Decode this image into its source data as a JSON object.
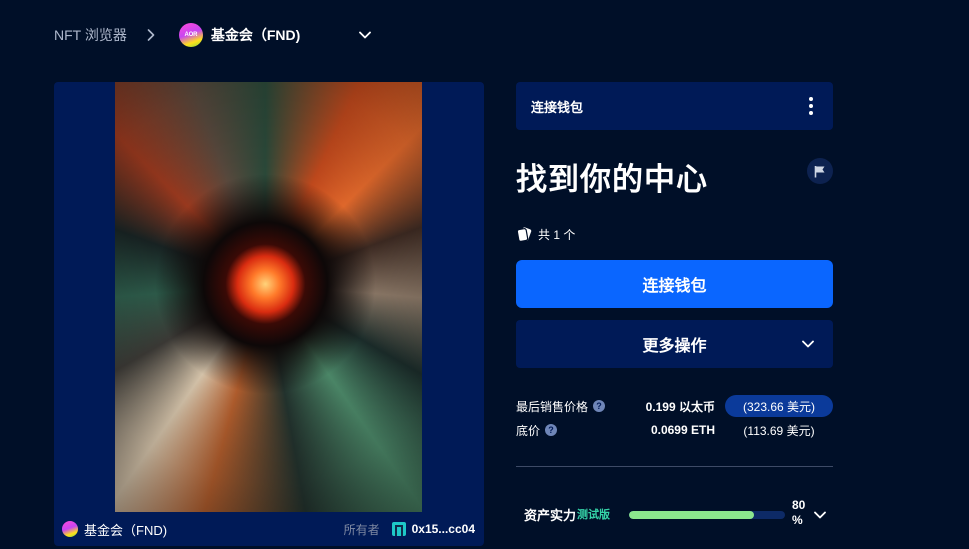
{
  "breadcrumb": {
    "root": "NFT 浏览器",
    "collection_avatar_text": "AOR",
    "collection": "基金会（FND)"
  },
  "media": {
    "collection": "基金会（FND)",
    "owner_label": "所有者",
    "owner": "0x15...cc04"
  },
  "topbar": {
    "label": "连接钱包"
  },
  "nft": {
    "title": "找到你的中心",
    "count": "共 1 个"
  },
  "actions": {
    "connect": "连接钱包",
    "more": "更多操作"
  },
  "prices": {
    "last_sale_label": "最后销售价格",
    "last_sale_value": "0.199 以太币",
    "last_sale_fiat": "(323.66 美元)",
    "floor_label": "底价",
    "floor_value": "0.0699 ETH",
    "floor_fiat": "(113.69 美元)"
  },
  "asset_strength": {
    "label": "资产实力",
    "beta": "测试版",
    "percent": "80 %",
    "percent_value": 80
  },
  "colors": {
    "background": "#000f28",
    "card": "#001a57",
    "primary_button": "#0a66ff",
    "progress": "#8be68e",
    "beta": "#35d4a8"
  },
  "icons": [
    "chevron-right-icon",
    "chevron-down-icon",
    "more-vertical-icon",
    "flag-icon",
    "cards-icon",
    "help-icon",
    "owner-icon"
  ]
}
